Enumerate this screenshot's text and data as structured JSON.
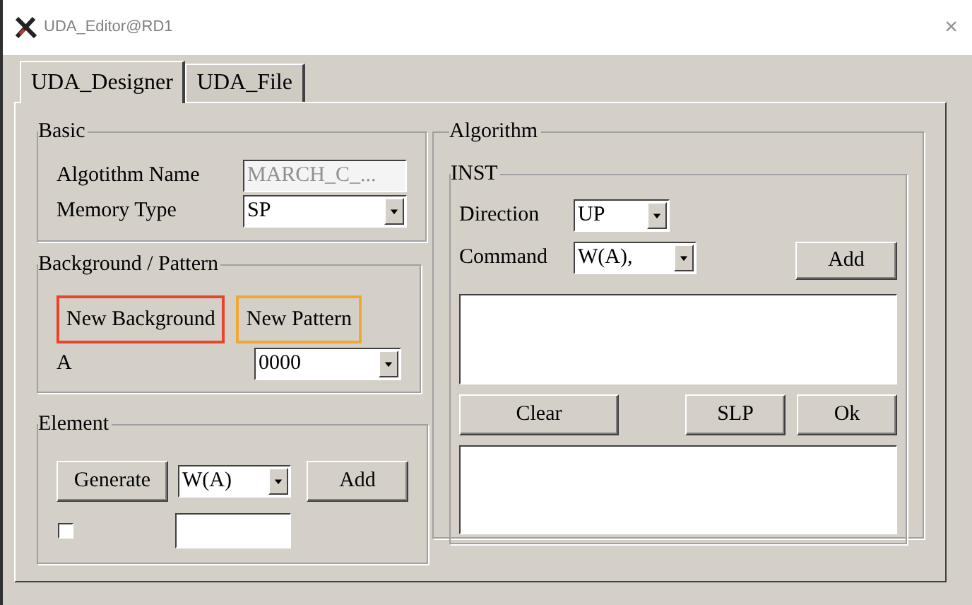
{
  "window": {
    "title": "UDA_Editor@RD1",
    "close": "×"
  },
  "tabs": [
    {
      "label": "UDA_Designer",
      "selected": true
    },
    {
      "label": "UDA_File",
      "selected": false
    }
  ],
  "basic": {
    "legend": "Basic",
    "name": {
      "label": "Algotithm Name",
      "value": "MARCH_C_...",
      "disabled": true
    },
    "memory_type": {
      "label": "Memory Type",
      "value": "SP"
    }
  },
  "background_pattern": {
    "legend": "Background / Pattern",
    "buttons": [
      {
        "label": "New Background",
        "color": "#e8452c"
      },
      {
        "label": "New Pattern",
        "color": "#f0a830"
      }
    ],
    "a": {
      "label": "A",
      "value": "0000"
    }
  },
  "element": {
    "legend": "Element",
    "generate": "Generate",
    "command": "W(A)",
    "add": "Add",
    "checkbox": {
      "checked": false
    }
  },
  "algorithm": {
    "legend": "Algorithm",
    "inst": {
      "legend": "INST",
      "direction": {
        "label": "Direction",
        "value": "UP"
      },
      "command": {
        "label": "Command",
        "value": "W(A),"
      },
      "add": "Add",
      "buttons": [
        "Clear",
        "SLP",
        "Ok"
      ]
    }
  }
}
